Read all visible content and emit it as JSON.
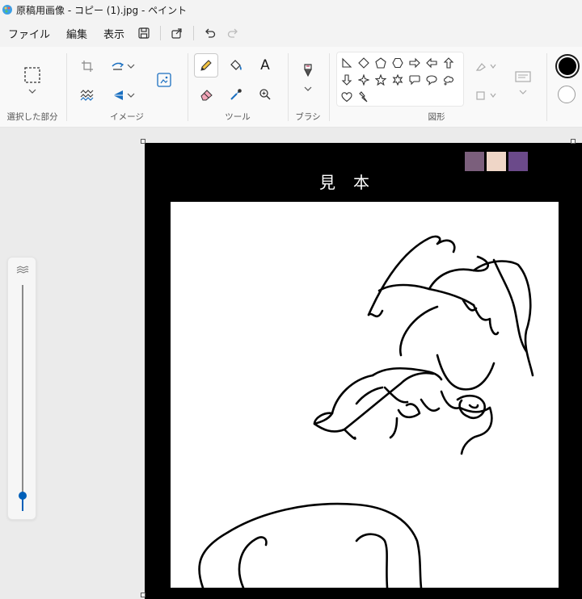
{
  "window": {
    "title": "原稿用画像 - コピー (1).jpg - ペイント"
  },
  "menu": {
    "file": "ファイル",
    "edit": "編集",
    "view": "表示"
  },
  "ribbon": {
    "groups": {
      "selection": "選択した部分",
      "image": "イメージ",
      "tools": "ツール",
      "brushes": "ブラシ",
      "shapes": "図形"
    },
    "text_tool_glyph": "A"
  },
  "canvas": {
    "sample_heading": "見本",
    "palette_swatches": [
      "#7b5f7c",
      "#efd6c7",
      "#6b4a8a"
    ]
  },
  "colors": {
    "primary": "#000000",
    "secondary": "#ffffff",
    "accent": "#005fb8"
  },
  "zoom": {
    "level_fraction": 0.05
  },
  "icons": {
    "app": "paint-app-icon",
    "save": "save-icon",
    "share": "share-icon",
    "undo": "undo-icon",
    "redo": "redo-icon"
  }
}
